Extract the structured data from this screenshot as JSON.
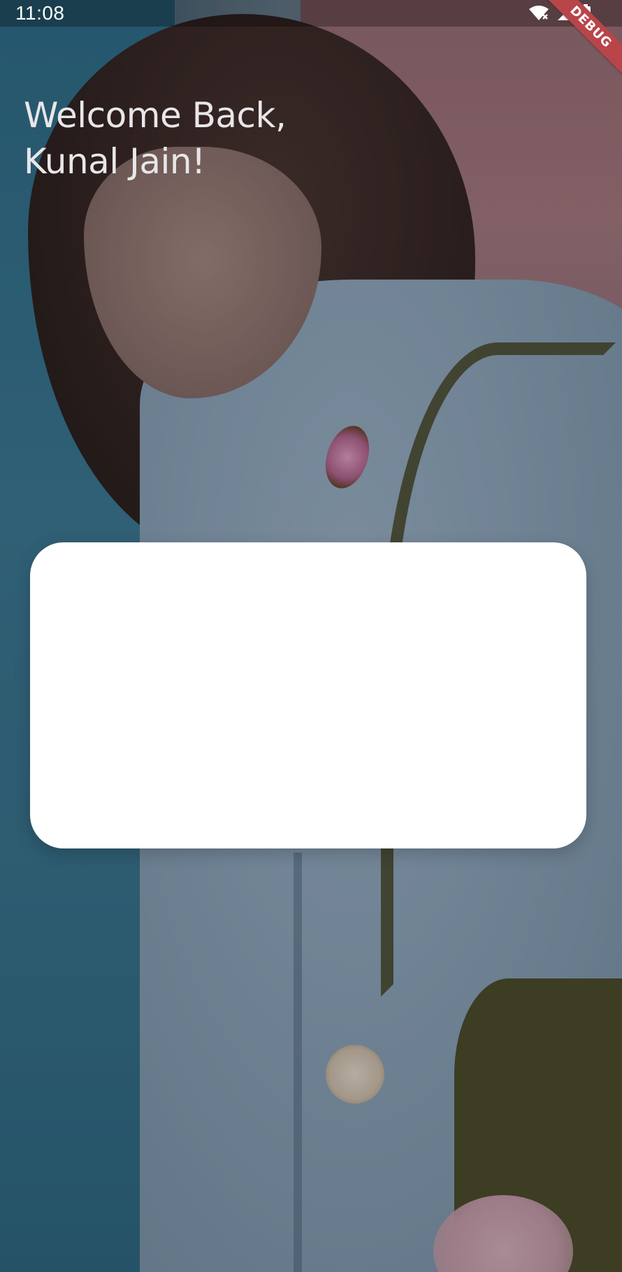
{
  "status_bar": {
    "time": "11:08",
    "icons": [
      "wifi-off-icon",
      "cell-signal-icon",
      "battery-charging-icon"
    ]
  },
  "debug_banner": {
    "label": "DEBUG",
    "color": "#b8454a"
  },
  "welcome": {
    "line1": "Welcome Back,",
    "line2": "Kunal Jain!"
  },
  "colors": {
    "heading": "#e8e6e8",
    "card": "#ffffff"
  }
}
